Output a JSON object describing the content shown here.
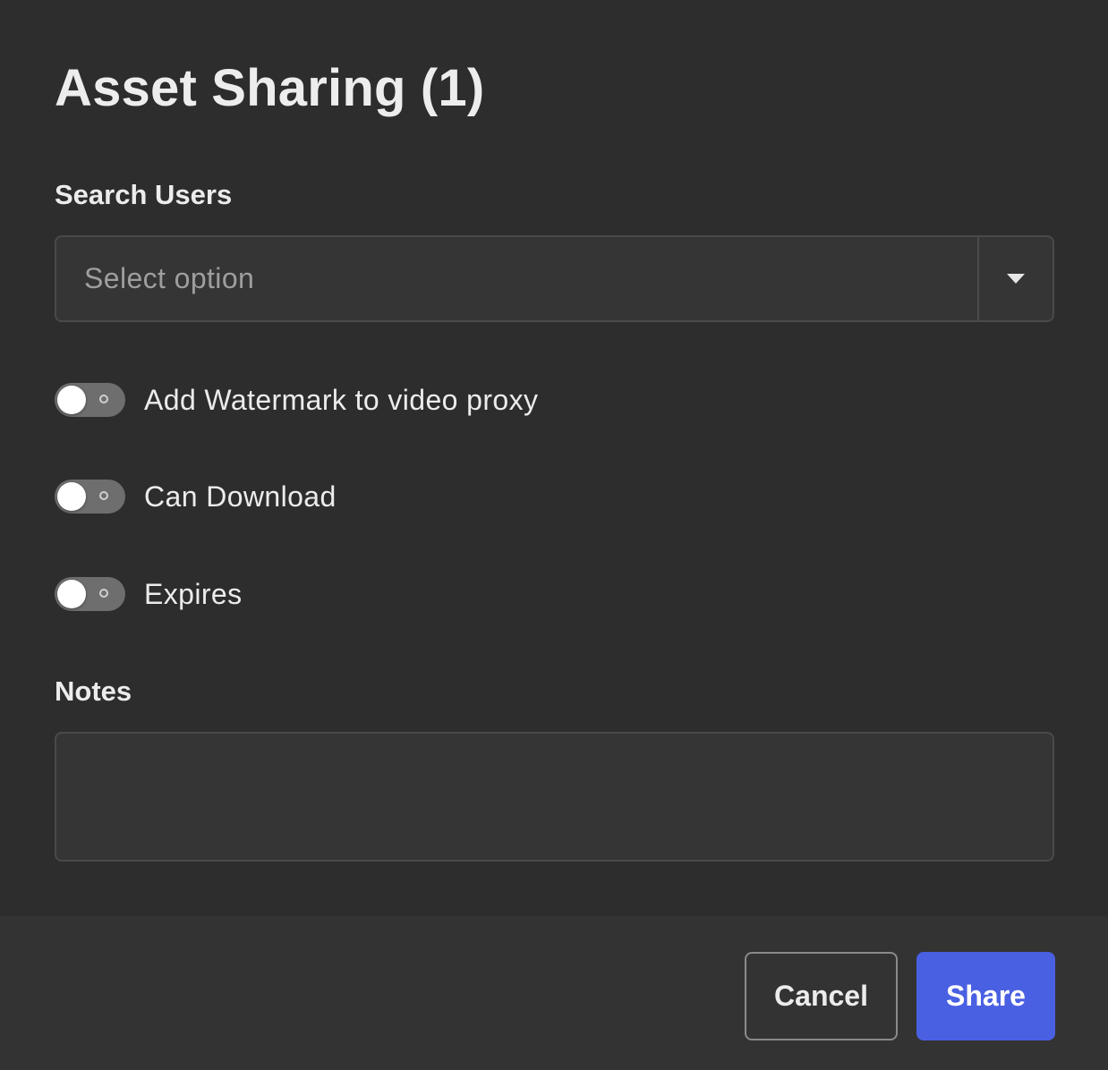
{
  "dialog": {
    "title": "Asset Sharing (1)"
  },
  "search_users": {
    "label": "Search Users",
    "placeholder": "Select option"
  },
  "toggles": [
    {
      "label": "Add Watermark to video proxy",
      "checked": false
    },
    {
      "label": "Can Download",
      "checked": false
    },
    {
      "label": "Expires",
      "checked": false
    }
  ],
  "notes": {
    "label": "Notes",
    "value": ""
  },
  "footer": {
    "cancel_label": "Cancel",
    "share_label": "Share"
  },
  "colors": {
    "background": "#2d2d2d",
    "footer_background": "#333333",
    "accent": "#4a60e3",
    "toggle_off": "#6e6e6e"
  },
  "icons": {
    "select_toggle": "chevron-down-icon"
  }
}
